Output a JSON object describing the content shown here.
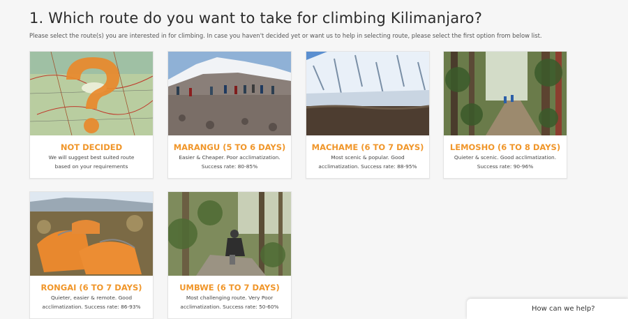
{
  "question": {
    "title": "1. Which route do you want to take for climbing Kilimanjaro?",
    "instructions": "Please select the route(s) you are interested in for climbing. In case you haven't decided yet or want us to help in selecting route, please select the first option from below list."
  },
  "routes": [
    {
      "name": "NOT DECIDED",
      "desc_lines": [
        "We will suggest best suited route",
        "based on your requirements"
      ],
      "image": "question-mark-over-map"
    },
    {
      "name": "MARANGU (5 TO 6 DAYS)",
      "desc_lines": [
        "Easier & Cheaper. Poor acclimatization.",
        "Success rate: 80-85%"
      ],
      "image": "hikers-on-rocky-slope"
    },
    {
      "name": "MACHAME (6 TO 7 DAYS)",
      "desc_lines": [
        "Most scenic & popular. Good",
        "acclimatization. Success rate: 88-95%"
      ],
      "image": "snowy-mountain-face"
    },
    {
      "name": "LEMOSHO (6 TO 8 DAYS)",
      "desc_lines": [
        "Quieter & scenic. Good acclimatization.",
        "Success rate: 90-96%"
      ],
      "image": "forest-trail"
    },
    {
      "name": "RONGAI (6 TO 7 DAYS)",
      "desc_lines": [
        "Quieter, easier & remote. Good",
        "acclimatization. Success rate: 86-93%"
      ],
      "image": "orange-tents-camp"
    },
    {
      "name": "UMBWE (6 TO 7 DAYS)",
      "desc_lines": [
        "Most challenging route. Very Poor",
        "acclimatization. Success rate: 50-60%"
      ],
      "image": "climber-in-rainforest"
    }
  ],
  "chat_widget": {
    "label": "How can we help?"
  },
  "colors": {
    "accent": "#f0962a",
    "background": "#f6f6f6"
  }
}
